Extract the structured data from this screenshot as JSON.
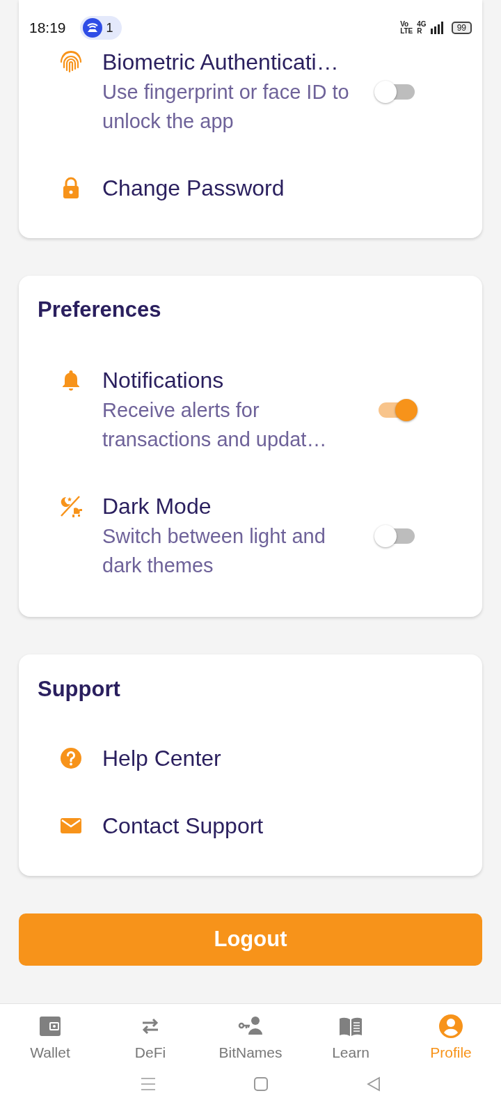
{
  "status_bar": {
    "time": "18:19",
    "notification_count": "1",
    "volte_top": "Vo",
    "volte_bottom": "LTE",
    "network_top": "4G",
    "network_bottom": "R",
    "battery": "99"
  },
  "sections": [
    {
      "items": [
        {
          "kind": "toggle",
          "title": "Biometric Authenticati…",
          "subtitle": "Use fingerprint or face ID to unlock the app",
          "on": false
        },
        {
          "kind": "link",
          "title": "Change Password"
        }
      ]
    },
    {
      "title": "Preferences",
      "items": [
        {
          "kind": "toggle",
          "title": "Notifications",
          "subtitle": "Receive alerts for transactions and updat…",
          "on": true
        },
        {
          "kind": "toggle",
          "title": "Dark Mode",
          "subtitle": "Switch between light and dark themes",
          "on": false
        }
      ]
    },
    {
      "title": "Support",
      "items": [
        {
          "kind": "link",
          "title": "Help Center"
        },
        {
          "kind": "link",
          "title": "Contact Support"
        }
      ]
    }
  ],
  "logout_button": "Logout",
  "nav_tabs": [
    {
      "label": "Wallet",
      "selected": false
    },
    {
      "label": "DeFi",
      "selected": false
    },
    {
      "label": "BitNames",
      "selected": false
    },
    {
      "label": "Learn",
      "selected": false
    },
    {
      "label": "Profile",
      "selected": true
    }
  ]
}
